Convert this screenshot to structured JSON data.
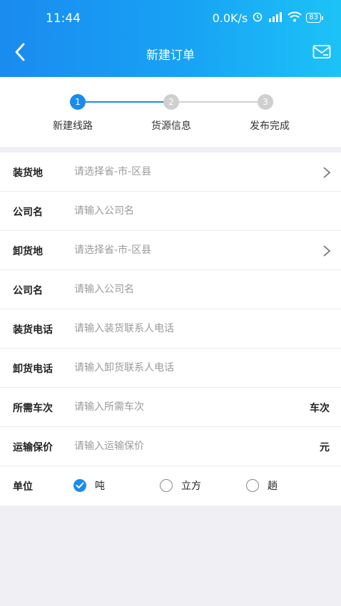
{
  "status_bar": {
    "time": "11:44",
    "network_speed": "0.0K/s",
    "battery": "83"
  },
  "header": {
    "title": "新建订单"
  },
  "steps": [
    {
      "number": "1",
      "label": "新建线路",
      "active": true
    },
    {
      "number": "2",
      "label": "货源信息",
      "active": false
    },
    {
      "number": "3",
      "label": "发布完成",
      "active": false
    }
  ],
  "form": {
    "load_place": {
      "label": "装货地",
      "placeholder": "请选择省-市-区县"
    },
    "load_company": {
      "label": "公司名",
      "placeholder": "请输入公司名"
    },
    "unload_place": {
      "label": "卸货地",
      "placeholder": "请选择省-市-区县"
    },
    "unload_company": {
      "label": "公司名",
      "placeholder": "请输入公司名"
    },
    "load_phone": {
      "label": "装货电话",
      "placeholder": "请输入装货联系人电话"
    },
    "unload_phone": {
      "label": "卸货电话",
      "placeholder": "请输入卸货联系人电话"
    },
    "trips": {
      "label": "所需车次",
      "placeholder": "请输入所需车次",
      "unit": "车次"
    },
    "insurance": {
      "label": "运输保价",
      "placeholder": "请输入运输保价",
      "unit": "元"
    },
    "unit": {
      "label": "单位",
      "options": [
        {
          "label": "吨",
          "selected": true
        },
        {
          "label": "立方",
          "selected": false
        },
        {
          "label": "趟",
          "selected": false
        }
      ]
    }
  },
  "colors": {
    "accent": "#1a8bf0",
    "inactive_step": "#cfcfcf"
  },
  "icons": {
    "back": "chevron-left-icon",
    "mail": "mail-icon",
    "row_arrow": "chevron-right-icon"
  }
}
